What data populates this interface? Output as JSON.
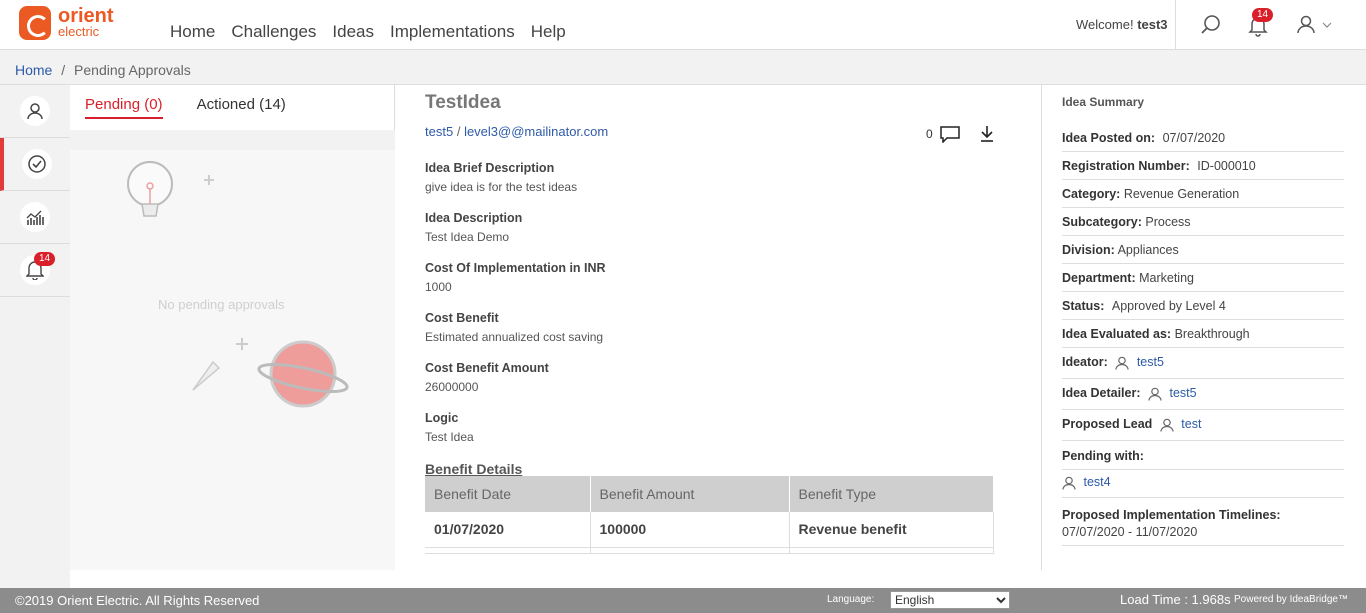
{
  "header": {
    "logo_line1": "orient",
    "logo_line2": "electric",
    "nav": [
      "Home",
      "Challenges",
      "Ideas",
      "Implementations",
      "Help"
    ],
    "welcome_prefix": "Welcome!",
    "welcome_user": "test3",
    "notification_count": "14"
  },
  "breadcrumb": {
    "home": "Home",
    "sep": "/",
    "current": "Pending Approvals"
  },
  "siderail": {
    "notification_count": "14"
  },
  "left_panel": {
    "tab_pending": "Pending (0)",
    "tab_actioned": "Actioned (14)",
    "empty_text": "No pending approvals"
  },
  "idea": {
    "title": "TestIdea",
    "author": "test5",
    "separator": "/",
    "approver": "level3@@mailinator.com",
    "comment_count": "0",
    "fields": [
      {
        "label": "Idea Brief Description",
        "value": "give idea is for the test ideas"
      },
      {
        "label": "Idea Description",
        "value": "Test Idea Demo"
      },
      {
        "label": "Cost Of Implementation in INR",
        "value": "1000"
      },
      {
        "label": "Cost Benefit",
        "value": "Estimated annualized cost saving"
      },
      {
        "label": "Cost Benefit Amount",
        "value": "26000000"
      },
      {
        "label": "Logic",
        "value": "Test Idea"
      }
    ],
    "benefit_title": "Benefit Details",
    "benefit_headers": [
      "Benefit Date",
      "Benefit Amount",
      "Benefit Type"
    ],
    "benefit_rows": [
      [
        "01/07/2020",
        "100000",
        "Revenue benefit"
      ]
    ]
  },
  "summary": {
    "title": "Idea Summary",
    "posted_label": "Idea Posted on:",
    "posted_value": "07/07/2020",
    "reg_label": "Registration Number:",
    "reg_value": "ID-000010",
    "cat_label": "Category:",
    "cat_value": "Revenue Generation",
    "subcat_label": "Subcategory:",
    "subcat_value": "Process",
    "div_label": "Division:",
    "div_value": "Appliances",
    "dept_label": "Department:",
    "dept_value": "Marketing",
    "status_label": "Status:",
    "status_value": "Approved by Level 4",
    "eval_label": "Idea Evaluated as:",
    "eval_value": "Breakthrough",
    "ideator_label": "Ideator:",
    "ideator_value": "test5",
    "detailer_label": "Idea Detailer:",
    "detailer_value": "test5",
    "lead_label": "Proposed Lead",
    "lead_value": "test",
    "pending_label": "Pending with:",
    "pending_value": "test4",
    "timeline_label": "Proposed Implementation Timelines:",
    "timeline_value": "07/07/2020 - 11/07/2020"
  },
  "footer": {
    "copyright": "©2019 Orient Electric. All Rights Reserved",
    "language_label": "Language:",
    "language_value": "English",
    "load_time": "Load Time : 1.968s",
    "powered": "Powered by IdeaBridge™"
  }
}
